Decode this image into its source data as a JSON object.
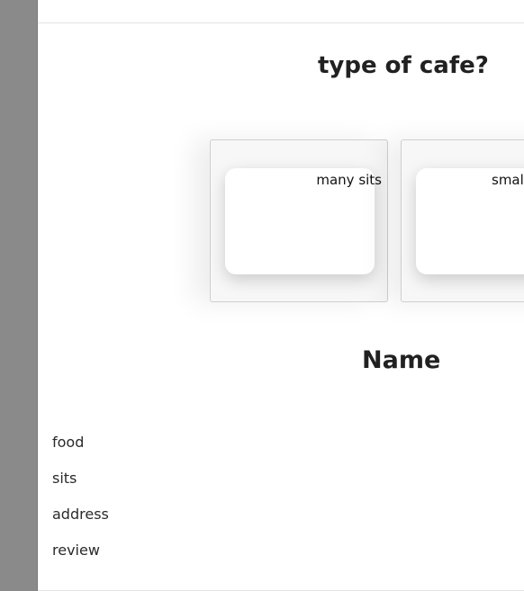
{
  "question": {
    "title": "type of cafe?"
  },
  "options": [
    {
      "label": "many sits"
    },
    {
      "label": "smal"
    }
  ],
  "section": {
    "heading": "Name"
  },
  "fields": [
    {
      "label": "food"
    },
    {
      "label": "sits"
    },
    {
      "label": "address"
    },
    {
      "label": "review"
    }
  ],
  "colors": {
    "rail": "#8a8a8a",
    "card_bg": "#f7f7f7",
    "text": "#212121"
  }
}
